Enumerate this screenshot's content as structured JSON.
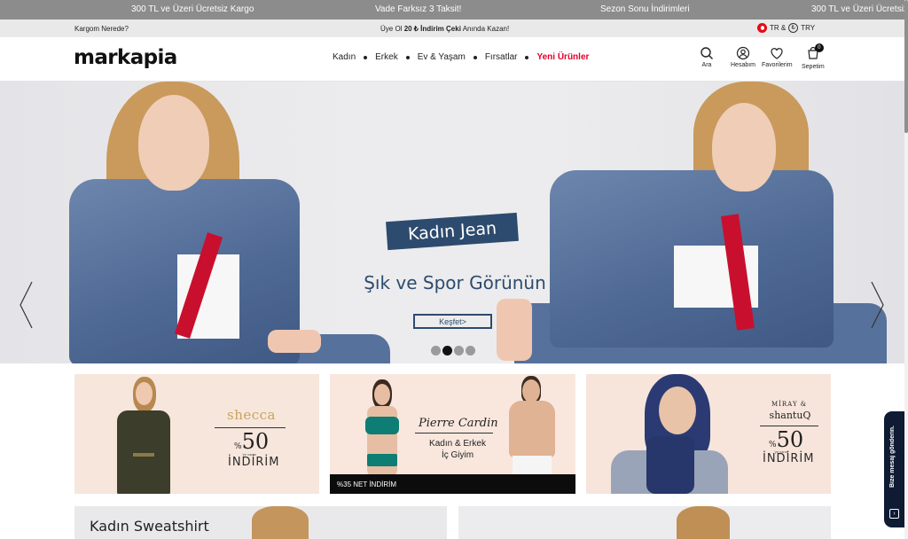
{
  "announcement": {
    "items": [
      "300 TL ve Üzeri Ücretsiz Kargo",
      "Vade Farksız 3 Taksit!",
      "Sezon Sonu İndirimleri",
      "300 TL ve Üzeri Ücretsiz Kargo"
    ]
  },
  "utility": {
    "track_order": "Kargom Nerede?",
    "promo_prefix": "Üye Ol",
    "promo_bold": "20 ₺ İndirim Çeki",
    "promo_suffix": "Anında Kazan!",
    "language": "TR &",
    "currency_symbol": "₺",
    "currency": "TRY"
  },
  "header": {
    "logo": "markapia",
    "nav": [
      "Kadın",
      "Erkek",
      "Ev & Yaşam",
      "Fırsatlar",
      "Yeni Ürünler"
    ],
    "icons": {
      "search": "Ara",
      "account": "Hesabım",
      "favorites": "Favorilerim",
      "cart": "Sepetim",
      "cart_count": "0"
    }
  },
  "hero": {
    "badge": "Kadın Jean",
    "subtitle": "Şık ve Spor Görünün",
    "cta": "Keşfet>",
    "slide_count": 4,
    "active_slide": 2
  },
  "banners": {
    "shecca": {
      "brand": "shecca",
      "percent": "%50",
      "small_caption": "'ye varan",
      "indirim": "İNDİRİM"
    },
    "cardin": {
      "brand": "Pierre Cardin",
      "line1": "Kadın & Erkek",
      "line2": "İç Giyim",
      "bar": "%35 NET İNDİRİM"
    },
    "miray": {
      "brand1": "MİRAY &",
      "brand2": "shantuQ",
      "percent": "%50",
      "small_caption": "'ye varan",
      "indirim": "İNDİRİM"
    }
  },
  "categories": {
    "left_title": "Kadın Sweatshirt"
  },
  "feedback": {
    "label": "Bize mesaj gönderin."
  },
  "colors": {
    "brand_navy": "#2d4b6e",
    "highlight_red": "#e4002b",
    "banner_peach": "#f7e6dc",
    "announce_gray": "#8c8c8c"
  }
}
